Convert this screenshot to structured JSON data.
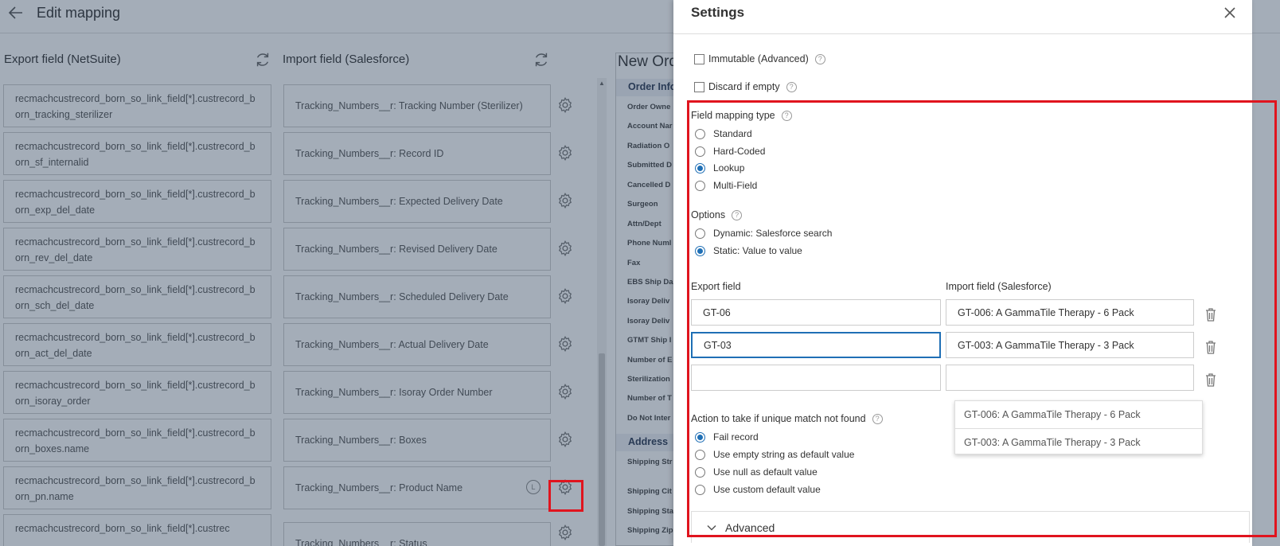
{
  "page": {
    "title": "Edit mapping",
    "export_column_title": "Export field (NetSuite)",
    "import_column_title": "Import field (Salesforce)"
  },
  "mappings": [
    {
      "export": "recmachcustrecord_born_so_link_field[*].custrecord_born_tracking_sterilizer",
      "import": "Tracking_Numbers__r: Tracking Number (Sterilizer)"
    },
    {
      "export": "recmachcustrecord_born_so_link_field[*].custrecord_born_sf_internalid",
      "import": "Tracking_Numbers__r: Record ID"
    },
    {
      "export": "recmachcustrecord_born_so_link_field[*].custrecord_born_exp_del_date",
      "import": "Tracking_Numbers__r: Expected Delivery Date"
    },
    {
      "export": "recmachcustrecord_born_so_link_field[*].custrecord_born_rev_del_date",
      "import": "Tracking_Numbers__r: Revised Delivery Date"
    },
    {
      "export": "recmachcustrecord_born_so_link_field[*].custrecord_born_sch_del_date",
      "import": "Tracking_Numbers__r: Scheduled Delivery Date"
    },
    {
      "export": "recmachcustrecord_born_so_link_field[*].custrecord_born_act_del_date",
      "import": "Tracking_Numbers__r: Actual Delivery Date"
    },
    {
      "export": "recmachcustrecord_born_so_link_field[*].custrecord_born_isoray_order",
      "import": "Tracking_Numbers__r: Isoray Order Number"
    },
    {
      "export": "recmachcustrecord_born_so_link_field[*].custrecord_born_boxes.name",
      "import": "Tracking_Numbers__r: Boxes"
    },
    {
      "export": "recmachcustrecord_born_so_link_field[*].custrecord_born_pn.name",
      "import": "Tracking_Numbers__r: Product Name"
    },
    {
      "export": "recmachcustrecord_born_so_link_field[*].custrec",
      "import": "Tracking_Numbers__r: Status"
    }
  ],
  "lock_indicator": "L",
  "preview": {
    "title": "New Ord",
    "section_order": "Order Info",
    "fields": [
      "Order Owne",
      "Account Nar",
      "Radiation O",
      "Submitted D",
      "Cancelled D",
      "Surgeon",
      "Attn/Dept",
      "Phone Numl",
      "Fax",
      "EBS Ship Da",
      "Isoray Deliv",
      "Isoray Deliv",
      "GTMT Ship I",
      "Number of E",
      "Sterilization",
      "Number of T",
      "Do Not Inter"
    ],
    "section_address": "Address",
    "address_fields": [
      "Shipping Str",
      "Shipping Cit",
      "Shipping Sta",
      "Shipping Zip"
    ]
  },
  "settings": {
    "title": "Settings",
    "immutable_label": "Immutable (Advanced)",
    "discard_label": "Discard if empty",
    "help_glyph": "?",
    "field_mapping_type_label": "Field mapping type",
    "mapping_types": [
      {
        "label": "Standard",
        "selected": false
      },
      {
        "label": "Hard-Coded",
        "selected": false
      },
      {
        "label": "Lookup",
        "selected": true
      },
      {
        "label": "Multi-Field",
        "selected": false
      }
    ],
    "options_label": "Options",
    "options": [
      {
        "label": "Dynamic: Salesforce search",
        "selected": false
      },
      {
        "label": "Static: Value to value",
        "selected": true
      }
    ],
    "export_field_label": "Export field",
    "import_field_label": "Import field (Salesforce)",
    "lookup_rows": [
      {
        "export": "GT-06",
        "import": "GT-006: A GammaTile Therapy - 6 Pack"
      },
      {
        "export": "GT-03",
        "import": "GT-003: A GammaTile Therapy - 3 Pack"
      },
      {
        "export": "",
        "import": ""
      }
    ],
    "dropdown_options": [
      "GT-006: A GammaTile Therapy - 6 Pack",
      "GT-003: A GammaTile Therapy - 3 Pack"
    ],
    "action_label": "Action to take if unique match not found",
    "actions": [
      {
        "label": "Fail record",
        "selected": true
      },
      {
        "label": "Use empty string as default value",
        "selected": false
      },
      {
        "label": "Use null as default value",
        "selected": false
      },
      {
        "label": "Use custom default value",
        "selected": false
      }
    ],
    "advanced_label": "Advanced"
  },
  "colors": {
    "highlight": "#e0141e",
    "accent": "#1f6fb5",
    "overlay": "#263c56"
  }
}
